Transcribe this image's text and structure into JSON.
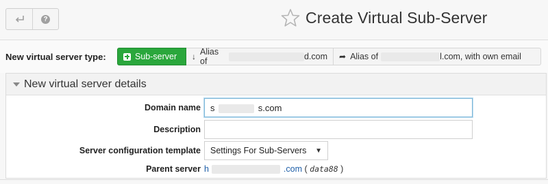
{
  "toolbar": {
    "back_icon": "arrow-back-icon",
    "help_icon": "help-circle-icon"
  },
  "header": {
    "title": "Create Virtual Sub-Server",
    "star_icon": "star-outline-icon"
  },
  "server_type": {
    "label": "New virtual server type:",
    "options": [
      {
        "label": "Sub-server",
        "active": true
      },
      {
        "label": "Alias of",
        "suffix": "d.com"
      },
      {
        "label": "Alias of",
        "suffix": "l.com, with own email"
      }
    ]
  },
  "details": {
    "title": "New virtual server details",
    "domain_label": "Domain name",
    "domain_value_prefix": "s",
    "domain_value_suffix": "s.com",
    "description_label": "Description",
    "description_value": "",
    "template_label": "Server configuration template",
    "template_value": "Settings For Sub-Servers",
    "parent_label": "Parent server",
    "parent_prefix": "h",
    "parent_suffix": ".com",
    "parent_host": "data88"
  },
  "colors": {
    "active_green": "#2aa73c",
    "link_blue": "#1f5fa8"
  }
}
